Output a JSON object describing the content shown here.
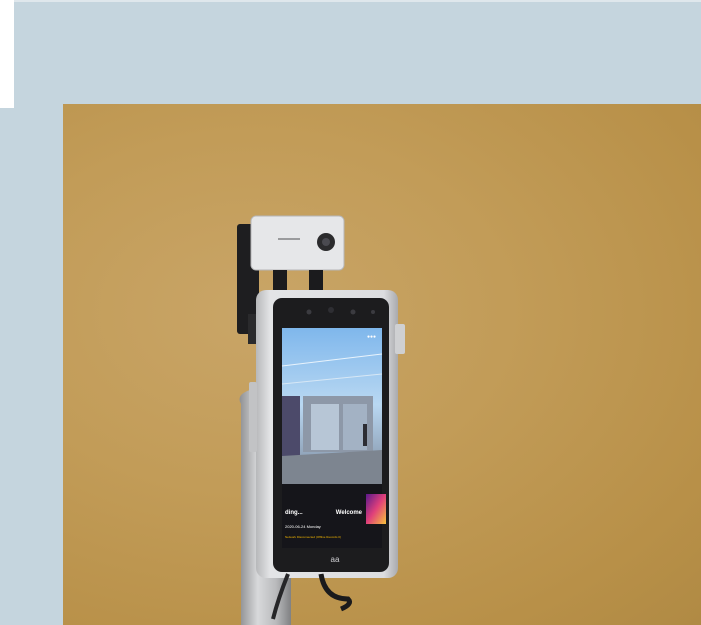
{
  "image": {
    "description_colors": {
      "frame_bg": "#c5d5de",
      "wall": "#c29c58",
      "device_body": "#d9dadc",
      "device_bezel": "#1c1c1e",
      "alert": "#f5b800"
    }
  },
  "device_screen": {
    "status_right": "●●●",
    "left_label": "ding...",
    "right_label": "Welcome",
    "date_line": "2020-06-24 Monday",
    "alert_line": "Network Disconnected (Offline Records 0)",
    "logo_text": "aa"
  }
}
